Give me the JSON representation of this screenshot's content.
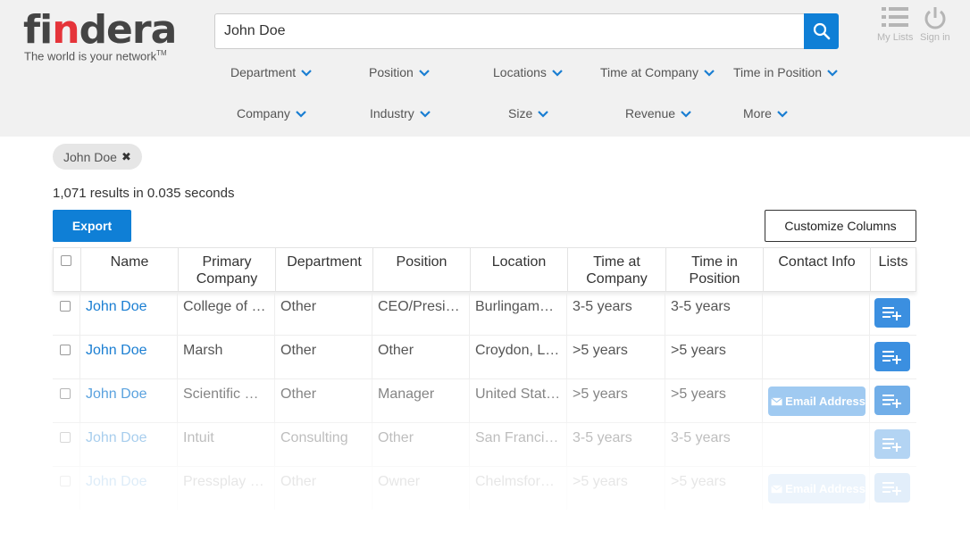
{
  "brand": {
    "logo_text_a": "fi",
    "logo_text_b": "n",
    "logo_text_c": "dera",
    "tagline": "The world is your network",
    "tagline_tm": "TM",
    "accent_color": "#0f7fd6",
    "logo_dot_color": "#e5343a"
  },
  "search": {
    "value": "John Doe",
    "placeholder": ""
  },
  "top_icons": {
    "my_lists": "My Lists",
    "sign_in": "Sign in"
  },
  "filters": {
    "row1": [
      "Department",
      "Position",
      "Locations",
      "Time at Company",
      "Time in Position"
    ],
    "row2": [
      "Company",
      "Industry",
      "Size",
      "Revenue",
      "More"
    ]
  },
  "chip": {
    "label": "John Doe"
  },
  "results_text": "1,071 results in 0.035 seconds",
  "buttons": {
    "export": "Export",
    "customize": "Customize Columns"
  },
  "table": {
    "headers": [
      "Name",
      "Primary Company",
      "Department",
      "Position",
      "Location",
      "Time at Company",
      "Time in Position",
      "Contact Info",
      "Lists"
    ],
    "rows": [
      {
        "name": "John Doe",
        "company": "College of S…",
        "department": "Other",
        "position": "CEO/Presid…",
        "location": "Burlingame,…",
        "time_company": "3-5 years",
        "time_position": "3-5 years",
        "contact": ""
      },
      {
        "name": "John Doe",
        "company": "Marsh",
        "department": "Other",
        "position": "Other",
        "location": "Croydon, Lo…",
        "time_company": ">5 years",
        "time_position": ">5 years",
        "contact": ""
      },
      {
        "name": "John Doe",
        "company": "Scientific Dr…",
        "department": "Other",
        "position": "Manager",
        "location": "United States",
        "time_company": ">5 years",
        "time_position": ">5 years",
        "contact": "Email Address"
      },
      {
        "name": "John Doe",
        "company": "Intuit",
        "department": "Consulting",
        "position": "Other",
        "location": "San Francis…",
        "time_company": "3-5 years",
        "time_position": "3-5 years",
        "contact": ""
      },
      {
        "name": "John Doe",
        "company": "Pressplay Ltd",
        "department": "Other",
        "position": "Owner",
        "location": "Chelmsford…",
        "time_company": ">5 years",
        "time_position": ">5 years",
        "contact": "Email Address"
      }
    ]
  }
}
